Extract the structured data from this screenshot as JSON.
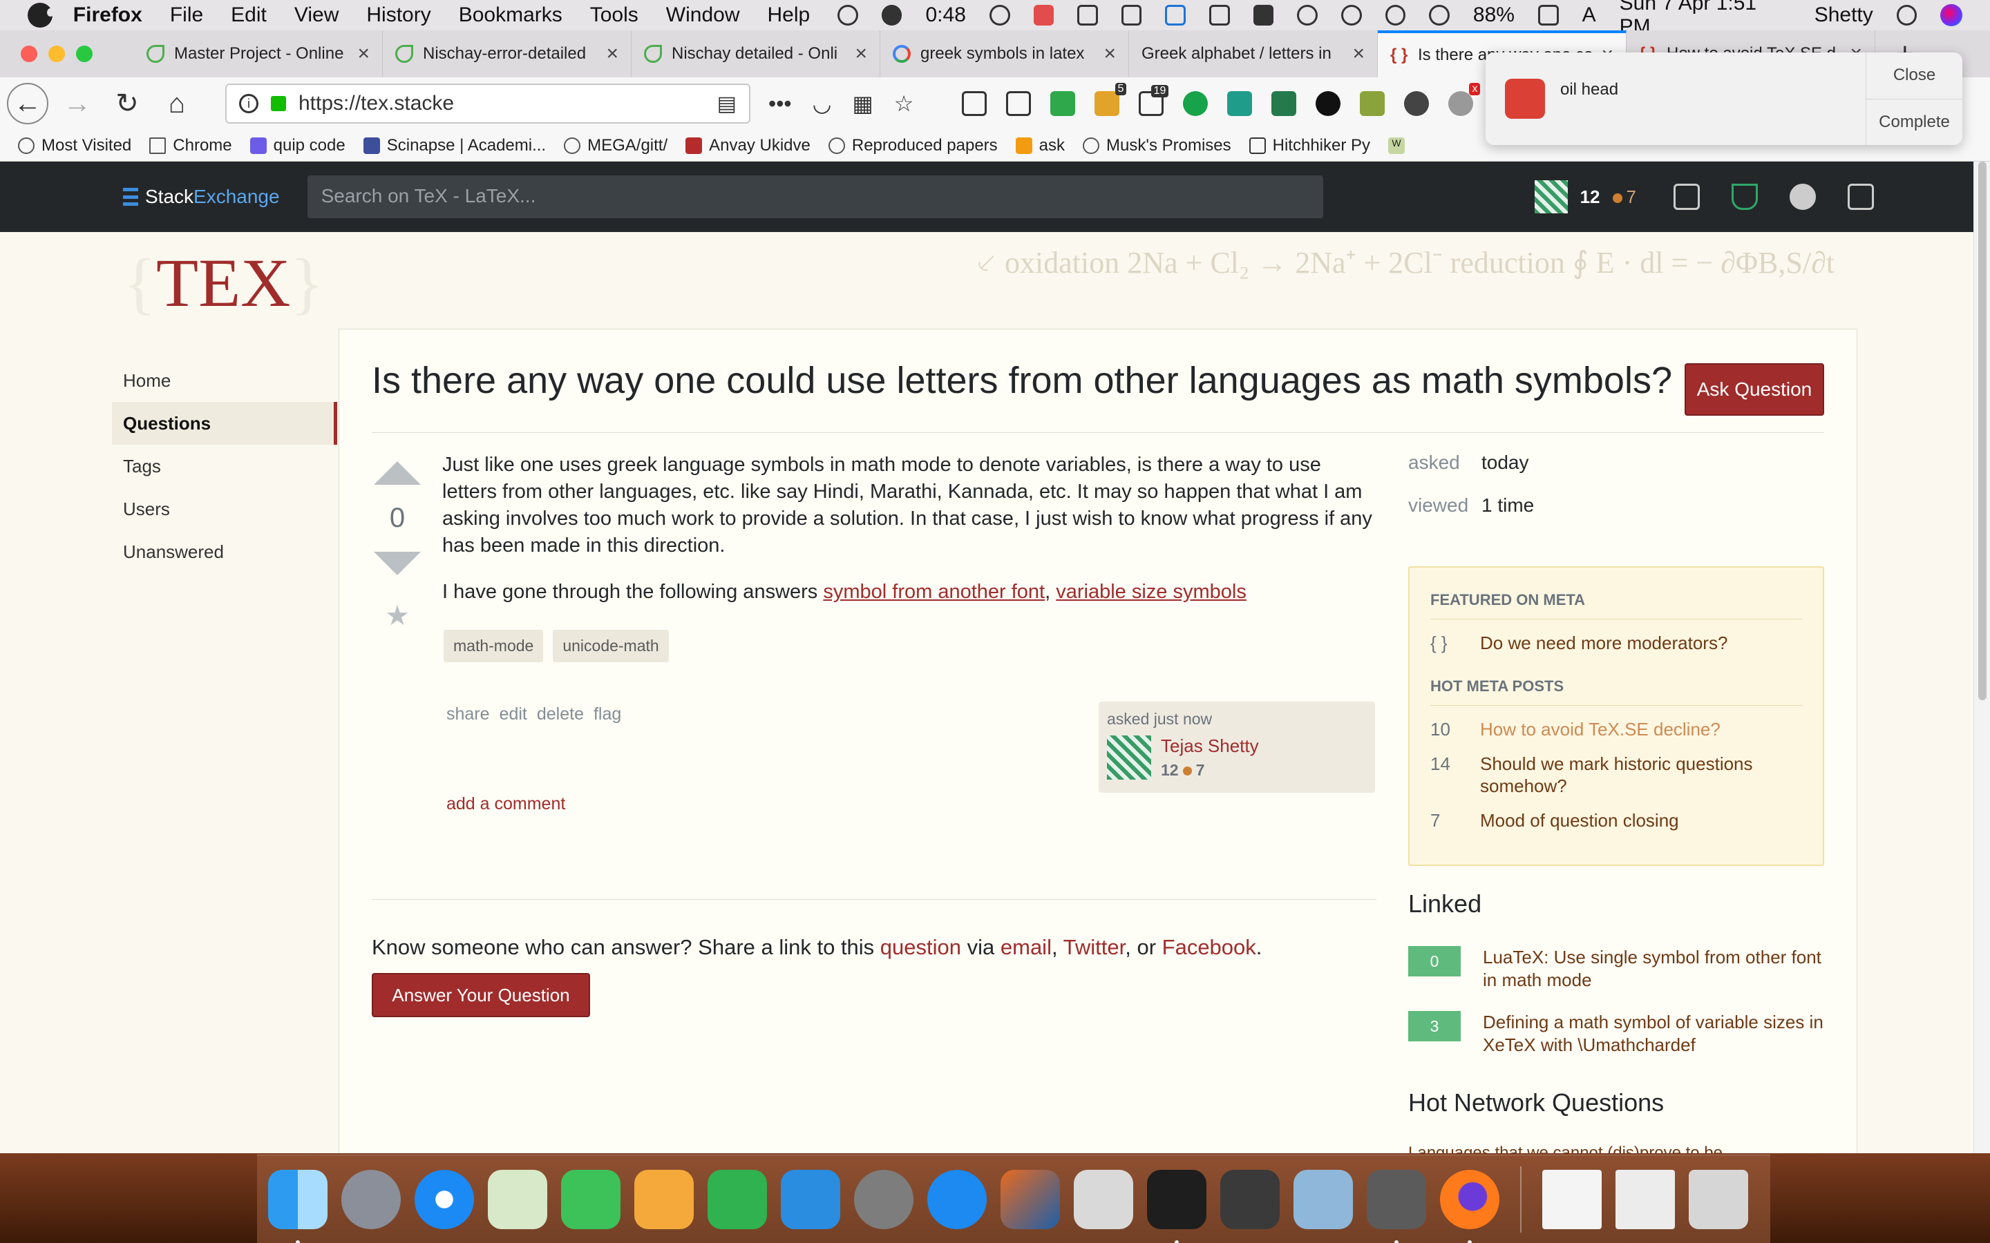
{
  "menubar": {
    "app": "Firefox",
    "items": [
      "File",
      "Edit",
      "View",
      "History",
      "Bookmarks",
      "Tools",
      "Window",
      "Help"
    ],
    "clock_timer": "0:48",
    "battery": "88%",
    "input_source": "A",
    "datetime": "Sun 7 Apr  1:51 PM",
    "user": "Shetty"
  },
  "tabs": [
    {
      "label": "Master Project - Online",
      "icon": "overleaf-leaf-icon"
    },
    {
      "label": "Nischay-error-detailed",
      "icon": "overleaf-leaf-icon"
    },
    {
      "label": "Nischay detailed - Onli",
      "icon": "overleaf-leaf-icon"
    },
    {
      "label": "greek symbols in latex",
      "icon": "google-icon"
    },
    {
      "label": "Greek alphabet / letters in",
      "icon": "none"
    },
    {
      "label": "Is there any way one co",
      "icon": "tex-se-icon",
      "active": true
    },
    {
      "label": "How to avoid TeX.SE d",
      "icon": "tex-se-icon"
    }
  ],
  "url": "https://tex.stacke",
  "ext_badges": {
    "downloads": "5",
    "notes": "19",
    "x_ext": "x"
  },
  "bookmarks": [
    "Most Visited",
    "Chrome",
    "quip code",
    "Scinapse | Academi...",
    "MEGA/gitt/",
    "Anvay Ukidve",
    "Reproduced papers",
    "ask",
    "Musk's Promises",
    "Hitchhiker Py",
    "W"
  ],
  "notification": {
    "title": "oil head",
    "close": "Close",
    "complete": "Complete"
  },
  "se": {
    "logo_stack": "Stack",
    "logo_exchange": "Exchange",
    "search_placeholder": "Search on TeX - LaTeX...",
    "reputation": "12",
    "bronze": "7"
  },
  "site": {
    "logo": "TEX",
    "brace_left": "{",
    "brace_right": "}",
    "banner_art": "⸔ oxidation  2Na + Cl₂ → 2Na⁺ + 2Cl⁻  reduction   ∮ E · dl = − ∂ΦB,S/∂t"
  },
  "leftnav": [
    "Home",
    "Questions",
    "Tags",
    "Users",
    "Unanswered"
  ],
  "question": {
    "title": "Is there any way one could use letters from other languages as math symbols?",
    "ask_button": "Ask Question",
    "votes": "0",
    "body_p1": "Just like one uses greek language symbols in math mode to denote variables, is there a way to use letters from other languages, etc. like say Hindi, Marathi, Kannada, etc. It may so happen that what I am asking involves too much work to provide a solution. In that case, I just wish to know what progress if any has been made in this direction.",
    "body_p2_prefix": "I have gone through the following answers ",
    "link1": "symbol from another font",
    "link_sep": ", ",
    "link2": "variable size symbols",
    "tags": [
      "math-mode",
      "unicode-math"
    ],
    "menu": [
      "share",
      "edit",
      "delete",
      "flag"
    ],
    "asked_label": "asked just now",
    "author": "Tejas Shetty",
    "author_rep": "12",
    "author_bronze": "7",
    "add_comment": "add a comment"
  },
  "share": {
    "prefix": "Know someone who can answer? Share a link to this ",
    "question_link": "question",
    "via": " via ",
    "email": "email",
    "comma": ", ",
    "twitter": "Twitter",
    "or": ", or ",
    "facebook": "Facebook",
    "period": ".",
    "answer_button": "Answer Your Question"
  },
  "stats": {
    "asked_label": "asked",
    "asked_value": "today",
    "viewed_label": "viewed",
    "viewed_value": "1 time"
  },
  "meta": {
    "featured_heading": "FEATURED ON META",
    "featured": [
      {
        "num": "{ }",
        "title": "Do we need more moderators?"
      }
    ],
    "hot_heading": "HOT META POSTS",
    "hot": [
      {
        "num": "10",
        "title": "How to avoid TeX.SE decline?",
        "visited": true
      },
      {
        "num": "14",
        "title": "Should we mark historic questions somehow?"
      },
      {
        "num": "7",
        "title": "Mood of question closing"
      }
    ]
  },
  "linked": {
    "heading": "Linked",
    "items": [
      {
        "score": "0",
        "title": "LuaTeX: Use single symbol from other font in math mode"
      },
      {
        "score": "3",
        "title": "Defining a math symbol of variable sizes in XeTeX with \\Umathchardef"
      }
    ]
  },
  "hot_network": {
    "heading": "Hot Network Questions",
    "first_item": "Languages that we cannot (dis)prove to be..."
  },
  "colors": {
    "accent": "#a02c2c",
    "se_bar": "#242729",
    "page_bg": "#fbf8ef",
    "meta_bg": "#fdf7e2",
    "answered": "#5fba7d"
  },
  "dock_apps": [
    "finder-icon",
    "launchpad-icon",
    "safari-icon",
    "maps-icon",
    "facetime-icon",
    "pages-icon",
    "numbers-icon",
    "keynote-icon",
    "system-preferences-icon",
    "app-store-icon",
    "matlab-icon",
    "scissors-icon",
    "terminal-icon",
    "screen-capture-icon",
    "preview-icon",
    "texmaker-icon",
    "firefox-icon",
    "document-icon",
    "spreadsheet-icon",
    "trash-icon"
  ]
}
